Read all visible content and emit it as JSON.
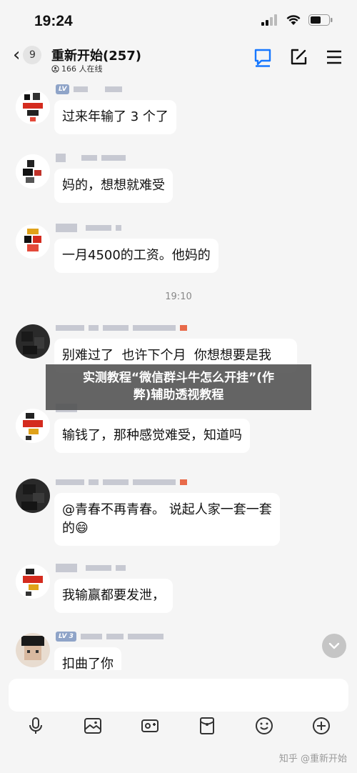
{
  "status_bar": {
    "time": "19:24"
  },
  "header": {
    "back_count": "9",
    "title": "重新开始(257)",
    "online": "166 人在线"
  },
  "messages": [
    {
      "text": "过来年输了 3 个了",
      "level": "LV"
    },
    {
      "text": "妈的，想想就难受",
      "level": ""
    },
    {
      "text": "一月4500的工资。他妈的",
      "level": ""
    },
    {
      "text": "别难过了  也许下个月  你想想要是我",
      "level": ""
    },
    {
      "text": "输钱了，那种感觉难受，知道吗",
      "level": ""
    },
    {
      "text": "@青春不再青春。 说起人家一套一套\n的😄",
      "level": ""
    },
    {
      "text": "我输赢都要发泄，",
      "level": ""
    },
    {
      "text": "扣曲了你",
      "level": "LV 3"
    }
  ],
  "timestamp": "19:10",
  "watermark": "实测教程“微信群斗牛怎么开挂”(作\n弊)辅助透视教程",
  "input": {
    "placeholder": ""
  },
  "credit": "知乎 @重新开始",
  "colors": {
    "background": "#f5f5f5",
    "bubble": "#ffffff",
    "watermark": "#505050"
  }
}
